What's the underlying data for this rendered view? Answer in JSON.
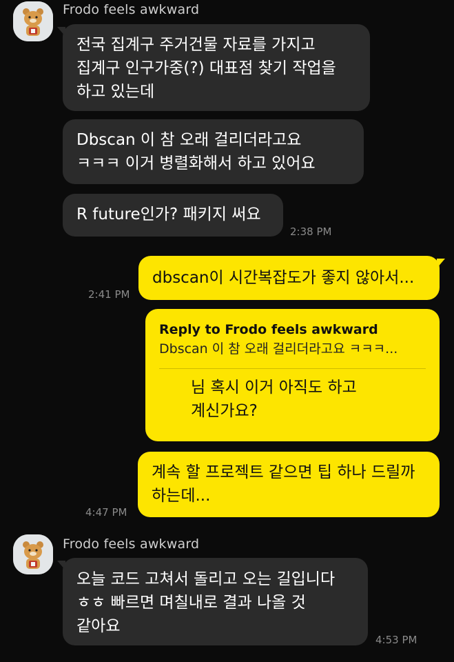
{
  "messages": {
    "group1": {
      "sender": "Frodo feels awkward",
      "m1": "전국 집계구 주거건물 자료를 가지고 집계구 인구가중(?) 대표점 찾기 작업을 하고 있는데",
      "m2": "Dbscan 이 참 오래 걸리더라고요 ㅋㅋㅋ 이거 병렬화해서 하고 있어요",
      "m3": "R future인가? 패키지 써요",
      "time": "2:38 PM"
    },
    "out1": {
      "text": "dbscan이 시간복잡도가 좋지 않아서...",
      "time": "2:41 PM"
    },
    "out2": {
      "reply_to": "Reply to Frodo feels awkward",
      "quote": "Dbscan 이 참 오래 걸리더라고요 ㅋㅋㅋ...",
      "text": "님 혹시 이거 아직도 하고 계신가요?"
    },
    "out3": {
      "text": "계속 할 프로젝트 같으면 팁 하나 드릴까 하는데...",
      "time": "4:47 PM"
    },
    "group2": {
      "sender": "Frodo feels awkward",
      "m1": "오늘 코드 고쳐서 돌리고 오는 길입니다 ㅎㅎ 빠르면 며칠내로 결과 나올 것 같아요",
      "time": "4:53 PM"
    }
  },
  "colors": {
    "background": "#0b0b0b",
    "incoming_bubble": "#2b2b2b",
    "outgoing_bubble": "#fde500"
  },
  "icons": {
    "avatar": "ryan-character-avatar"
  }
}
